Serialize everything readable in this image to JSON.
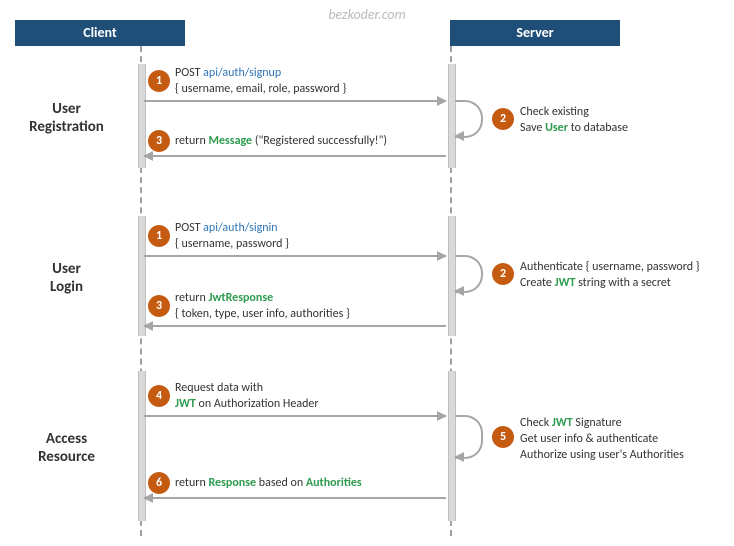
{
  "watermark": "bezkoder.com",
  "lanes": {
    "client": "Client",
    "server": "Server"
  },
  "sections": {
    "registration": "User\nRegistration",
    "login": "User\nLogin",
    "access": "Access\nResource"
  },
  "steps": {
    "reg1": {
      "num": "1",
      "line1_pre": "POST ",
      "line1_api": "api/auth/signup",
      "line2": "{ username, email, role, password }"
    },
    "reg2": {
      "num": "2",
      "line1": "Check existing",
      "line2_pre": "Save ",
      "line2_kw": "User",
      "line2_post": " to database"
    },
    "reg3": {
      "num": "3",
      "line1_pre": "return ",
      "line1_kw": "Message",
      "line1_post": " (\"Registered successfully!\")"
    },
    "login1": {
      "num": "1",
      "line1_pre": "POST ",
      "line1_api": "api/auth/signin",
      "line2": "{ username, password }"
    },
    "login2": {
      "num": "2",
      "line1": "Authenticate { username, password }",
      "line2_pre": "Create ",
      "line2_kw": "JWT",
      "line2_post": " string with a secret"
    },
    "login3": {
      "num": "3",
      "line1_pre": "return ",
      "line1_kw": "JwtResponse",
      "line2": "{ token, type, user info, authorities }"
    },
    "acc4": {
      "num": "4",
      "line1": "Request  data with",
      "line2_kw": "JWT",
      "line2_post": " on Authorization Header"
    },
    "acc5": {
      "num": "5",
      "line1_pre": "Check ",
      "line1_kw": "JWT",
      "line1_post": " Signature",
      "line2": "Get user info & authenticate",
      "line3": "Authorize using user's Authorities"
    },
    "acc6": {
      "num": "6",
      "line1_pre": "return ",
      "line1_kw": "Response",
      "line1_mid": " based on ",
      "line1_kw2": "Authorities"
    }
  }
}
